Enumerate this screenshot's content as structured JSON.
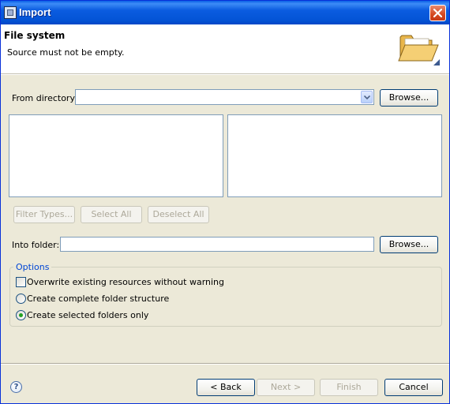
{
  "window": {
    "title": "Import",
    "icon": "eclipse-app-icon",
    "close_icon": "close-icon"
  },
  "banner": {
    "title": "File system",
    "message": "Source must not be empty.",
    "icon": "folder-open-icon"
  },
  "source": {
    "from_directory_label": "From directory:",
    "from_directory_value": "",
    "browse_label": "Browse..."
  },
  "selection_buttons": {
    "filter_types": "Filter Types...",
    "select_all": "Select All",
    "deselect_all": "Deselect All"
  },
  "destination": {
    "into_folder_label": "Into folder:",
    "into_folder_value": "",
    "browse_label": "Browse..."
  },
  "options": {
    "title": "Options",
    "overwrite_label": "Overwrite existing resources without warning",
    "overwrite_checked": false,
    "complete_structure_label": "Create complete folder structure",
    "selected_only_label": "Create selected folders only",
    "selected_radio": "selected_only"
  },
  "footer": {
    "help_icon": "help-icon",
    "help_glyph": "?",
    "back_label": "< Back",
    "next_label": "Next >",
    "finish_label": "Finish",
    "cancel_label": "Cancel"
  },
  "colors": {
    "title_bar": "#0454d6",
    "dialog_background": "#ece9d8",
    "group_title": "#0046d5",
    "radio_selected": "#21a121"
  }
}
